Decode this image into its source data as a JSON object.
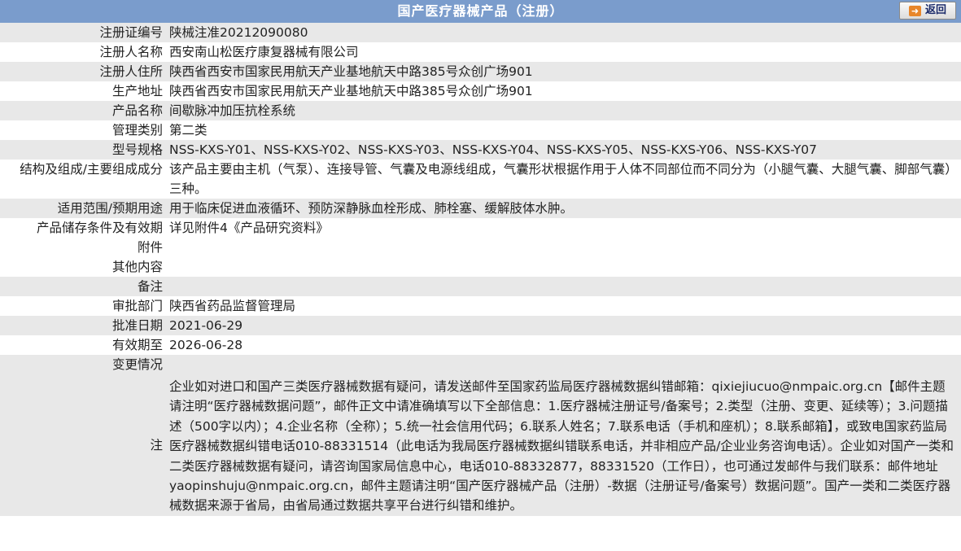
{
  "header": {
    "title": "国产医疗器械产品（注册）",
    "back_label": "返回"
  },
  "rows": {
    "reg_no": {
      "label": "注册证编号",
      "value": "陕械注准20212090080"
    },
    "registrant": {
      "label": "注册人名称",
      "value": "西安南山松医疗康复器械有限公司"
    },
    "registrant_address": {
      "label": "注册人住所",
      "value": "陕西省西安市国家民用航天产业基地航天中路385号众创广场901"
    },
    "production_address": {
      "label": "生产地址",
      "value": "陕西省西安市国家民用航天产业基地航天中路385号众创广场901"
    },
    "product_name": {
      "label": "产品名称",
      "value": "间歇脉冲加压抗栓系统"
    },
    "category": {
      "label": "管理类别",
      "value": "第二类"
    },
    "models": {
      "label": "型号规格",
      "value": "NSS-KXS-Y01、NSS-KXS-Y02、NSS-KXS-Y03、NSS-KXS-Y04、NSS-KXS-Y05、NSS-KXS-Y06、NSS-KXS-Y07"
    },
    "structure": {
      "label": "结构及组成/主要组成成分",
      "value": "该产品主要由主机（气泵）、连接导管、气囊及电源线组成，气囊形状根据作用于人体不同部位而不同分为（小腿气囊、大腿气囊、脚部气囊）三种。"
    },
    "scope": {
      "label": "适用范围/预期用途",
      "value": "用于临床促进血液循环、预防深静脉血栓形成、肺栓塞、缓解肢体水肿。"
    },
    "storage": {
      "label": "产品储存条件及有效期",
      "value": "详见附件4《产品研究资料》"
    },
    "attachment": {
      "label": "附件",
      "value": ""
    },
    "other": {
      "label": "其他内容",
      "value": ""
    },
    "remark": {
      "label": "备注",
      "value": ""
    },
    "authority": {
      "label": "审批部门",
      "value": "陕西省药品监督管理局"
    },
    "approval_date": {
      "label": "批准日期",
      "value": "2021-06-29"
    },
    "valid_until": {
      "label": "有效期至",
      "value": "2026-06-28"
    },
    "changes": {
      "label": "变更情况",
      "value": ""
    },
    "note": {
      "label": "注",
      "value": "企业如对进口和国产三类医疗器械数据有疑问，请发送邮件至国家药监局医疗器械数据纠错邮箱：qixiejiucuo@nmpaic.org.cn【邮件主题请注明“医疗器械数据问题”，邮件正文中请准确填写以下全部信息：1.医疗器械注册证号/备案号；2.类型（注册、变更、延续等）；3.问题描述（500字以内）；4.企业名称（全称）；5.统一社会信用代码；6.联系人姓名；7.联系电话（手机和座机）；8.联系邮箱】，或致电国家药监局医疗器械数据纠错电话010-88331514（此电话为我局医疗器械数据纠错联系电话，并非相应产品/企业业务咨询电话）。企业如对国产一类和二类医疗器械数据有疑问，请咨询国家局信息中心，电话010-88332877，88331520（工作日），也可通过发邮件与我们联系：邮件地址yaopinshuju@nmpaic.org.cn，邮件主题请注明“国产医疗器械产品（注册）-数据（注册证号/备案号）数据问题”。国产一类和二类医疗器械数据来源于省局，由省局通过数据共享平台进行纠错和维护。"
    }
  }
}
